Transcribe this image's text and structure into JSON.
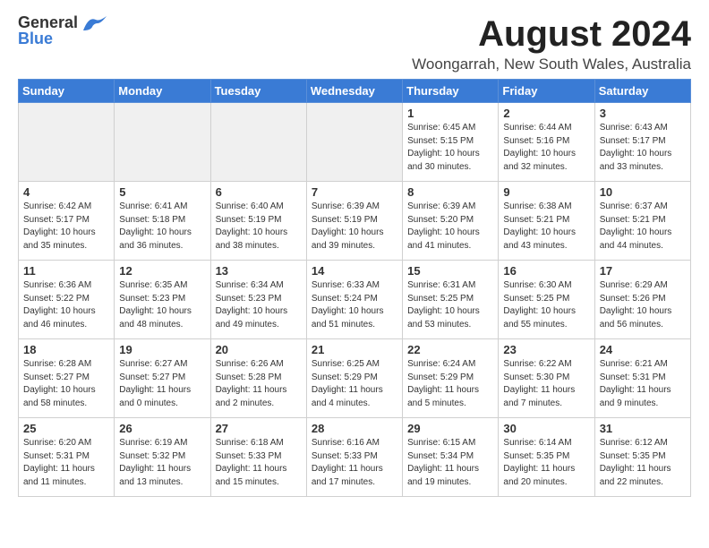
{
  "logo": {
    "general": "General",
    "blue": "Blue"
  },
  "title": "August 2024",
  "location": "Woongarrah, New South Wales, Australia",
  "weekdays": [
    "Sunday",
    "Monday",
    "Tuesday",
    "Wednesday",
    "Thursday",
    "Friday",
    "Saturday"
  ],
  "weeks": [
    [
      {
        "day": "",
        "info": "",
        "empty": true
      },
      {
        "day": "",
        "info": "",
        "empty": true
      },
      {
        "day": "",
        "info": "",
        "empty": true
      },
      {
        "day": "",
        "info": "",
        "empty": true
      },
      {
        "day": "1",
        "info": "Sunrise: 6:45 AM\nSunset: 5:15 PM\nDaylight: 10 hours\nand 30 minutes."
      },
      {
        "day": "2",
        "info": "Sunrise: 6:44 AM\nSunset: 5:16 PM\nDaylight: 10 hours\nand 32 minutes."
      },
      {
        "day": "3",
        "info": "Sunrise: 6:43 AM\nSunset: 5:17 PM\nDaylight: 10 hours\nand 33 minutes."
      }
    ],
    [
      {
        "day": "4",
        "info": "Sunrise: 6:42 AM\nSunset: 5:17 PM\nDaylight: 10 hours\nand 35 minutes."
      },
      {
        "day": "5",
        "info": "Sunrise: 6:41 AM\nSunset: 5:18 PM\nDaylight: 10 hours\nand 36 minutes."
      },
      {
        "day": "6",
        "info": "Sunrise: 6:40 AM\nSunset: 5:19 PM\nDaylight: 10 hours\nand 38 minutes."
      },
      {
        "day": "7",
        "info": "Sunrise: 6:39 AM\nSunset: 5:19 PM\nDaylight: 10 hours\nand 39 minutes."
      },
      {
        "day": "8",
        "info": "Sunrise: 6:39 AM\nSunset: 5:20 PM\nDaylight: 10 hours\nand 41 minutes."
      },
      {
        "day": "9",
        "info": "Sunrise: 6:38 AM\nSunset: 5:21 PM\nDaylight: 10 hours\nand 43 minutes."
      },
      {
        "day": "10",
        "info": "Sunrise: 6:37 AM\nSunset: 5:21 PM\nDaylight: 10 hours\nand 44 minutes."
      }
    ],
    [
      {
        "day": "11",
        "info": "Sunrise: 6:36 AM\nSunset: 5:22 PM\nDaylight: 10 hours\nand 46 minutes."
      },
      {
        "day": "12",
        "info": "Sunrise: 6:35 AM\nSunset: 5:23 PM\nDaylight: 10 hours\nand 48 minutes."
      },
      {
        "day": "13",
        "info": "Sunrise: 6:34 AM\nSunset: 5:23 PM\nDaylight: 10 hours\nand 49 minutes."
      },
      {
        "day": "14",
        "info": "Sunrise: 6:33 AM\nSunset: 5:24 PM\nDaylight: 10 hours\nand 51 minutes."
      },
      {
        "day": "15",
        "info": "Sunrise: 6:31 AM\nSunset: 5:25 PM\nDaylight: 10 hours\nand 53 minutes."
      },
      {
        "day": "16",
        "info": "Sunrise: 6:30 AM\nSunset: 5:25 PM\nDaylight: 10 hours\nand 55 minutes."
      },
      {
        "day": "17",
        "info": "Sunrise: 6:29 AM\nSunset: 5:26 PM\nDaylight: 10 hours\nand 56 minutes."
      }
    ],
    [
      {
        "day": "18",
        "info": "Sunrise: 6:28 AM\nSunset: 5:27 PM\nDaylight: 10 hours\nand 58 minutes."
      },
      {
        "day": "19",
        "info": "Sunrise: 6:27 AM\nSunset: 5:27 PM\nDaylight: 11 hours\nand 0 minutes."
      },
      {
        "day": "20",
        "info": "Sunrise: 6:26 AM\nSunset: 5:28 PM\nDaylight: 11 hours\nand 2 minutes."
      },
      {
        "day": "21",
        "info": "Sunrise: 6:25 AM\nSunset: 5:29 PM\nDaylight: 11 hours\nand 4 minutes."
      },
      {
        "day": "22",
        "info": "Sunrise: 6:24 AM\nSunset: 5:29 PM\nDaylight: 11 hours\nand 5 minutes."
      },
      {
        "day": "23",
        "info": "Sunrise: 6:22 AM\nSunset: 5:30 PM\nDaylight: 11 hours\nand 7 minutes."
      },
      {
        "day": "24",
        "info": "Sunrise: 6:21 AM\nSunset: 5:31 PM\nDaylight: 11 hours\nand 9 minutes."
      }
    ],
    [
      {
        "day": "25",
        "info": "Sunrise: 6:20 AM\nSunset: 5:31 PM\nDaylight: 11 hours\nand 11 minutes."
      },
      {
        "day": "26",
        "info": "Sunrise: 6:19 AM\nSunset: 5:32 PM\nDaylight: 11 hours\nand 13 minutes."
      },
      {
        "day": "27",
        "info": "Sunrise: 6:18 AM\nSunset: 5:33 PM\nDaylight: 11 hours\nand 15 minutes."
      },
      {
        "day": "28",
        "info": "Sunrise: 6:16 AM\nSunset: 5:33 PM\nDaylight: 11 hours\nand 17 minutes."
      },
      {
        "day": "29",
        "info": "Sunrise: 6:15 AM\nSunset: 5:34 PM\nDaylight: 11 hours\nand 19 minutes."
      },
      {
        "day": "30",
        "info": "Sunrise: 6:14 AM\nSunset: 5:35 PM\nDaylight: 11 hours\nand 20 minutes."
      },
      {
        "day": "31",
        "info": "Sunrise: 6:12 AM\nSunset: 5:35 PM\nDaylight: 11 hours\nand 22 minutes."
      }
    ]
  ]
}
